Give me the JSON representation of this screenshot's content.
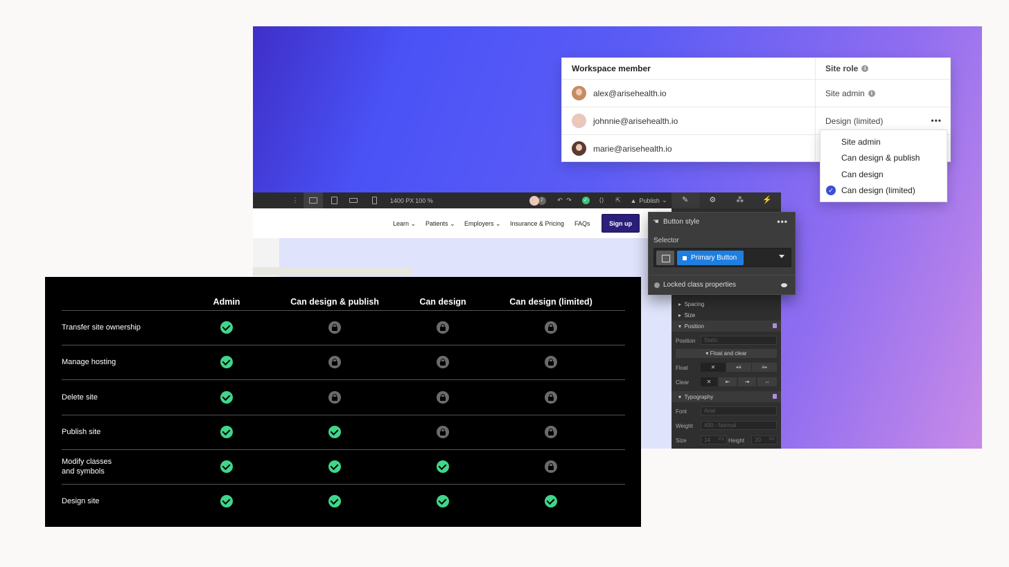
{
  "members_table": {
    "header_member": "Workspace member",
    "header_role": "Site role",
    "rows": [
      {
        "email": "alex@arisehealth.io",
        "role": "Site admin"
      },
      {
        "email": "johnnie@arisehealth.io",
        "role": "Design (limited)"
      },
      {
        "email": "marie@arisehealth.io",
        "role": ""
      }
    ],
    "more_label": "•••"
  },
  "role_menu": {
    "options": [
      "Site admin",
      "Can design & publish",
      "Can design",
      "Can design (limited)"
    ],
    "selected": "Can design (limited)"
  },
  "toolbar": {
    "width_readout": "1400 PX",
    "zoom_readout": "100 %",
    "collaborator_count": "2",
    "publish_label": "Publish"
  },
  "site": {
    "nav": [
      "Learn",
      "Patients",
      "Employers",
      "Insurance & Pricing",
      "FAQs"
    ],
    "signup_label": "Sign up"
  },
  "style_popover": {
    "title": "Button style",
    "selector_label": "Selector",
    "class_name": "Primary Button",
    "locked_label": "Locked class properties"
  },
  "style_panel": {
    "spacing": "Spacing",
    "size": "Size",
    "position": "Position",
    "position_label": "Position",
    "position_value": "Static",
    "float_and_clear": "Float and clear",
    "float_label": "Float",
    "clear_label": "Clear",
    "typography": "Typography",
    "font_label": "Font",
    "font_value": "Arial",
    "weight_label": "Weight",
    "weight_value": "400 - Normal",
    "size_label": "Size",
    "size_value": "14",
    "size_unit": "PX",
    "height_label": "Height",
    "height_value": "20",
    "height_unit": "PX"
  },
  "permissions": {
    "columns": [
      "Admin",
      "Can design & publish",
      "Can design",
      "Can design (limited)"
    ],
    "rows": [
      {
        "label": "Transfer site ownership",
        "access": [
          true,
          false,
          false,
          false
        ]
      },
      {
        "label": "Manage hosting",
        "access": [
          true,
          false,
          false,
          false
        ]
      },
      {
        "label": "Delete site",
        "access": [
          true,
          false,
          false,
          false
        ]
      },
      {
        "label": "Publish site",
        "access": [
          true,
          true,
          false,
          false
        ]
      },
      {
        "label": "Modify classes\nand symbols",
        "access": [
          true,
          true,
          true,
          false
        ]
      },
      {
        "label": "Design site",
        "access": [
          true,
          true,
          true,
          true
        ]
      }
    ]
  },
  "colors": {
    "check_green": "#40d68a",
    "locked_gray": "#6b6b6b",
    "primary_blue": "#1f7fe0",
    "signup_purple": "#2a1f7a"
  }
}
